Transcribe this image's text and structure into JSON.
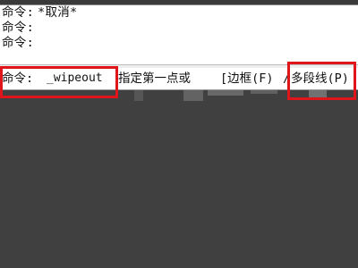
{
  "history": {
    "lines": [
      {
        "label": "命令:",
        "text": "*取消*"
      },
      {
        "label": "命令:",
        "text": ""
      },
      {
        "label": "命令:",
        "text": ""
      }
    ]
  },
  "command_line": {
    "label": "命令:",
    "input_value": "_wipeout",
    "prompt": "指定第一点或",
    "options": {
      "border": "[边框(F)",
      "separator": "/",
      "polyline": "多段线(P)"
    }
  },
  "colors": {
    "highlight": "#e0151b",
    "canvas_background": "#404040",
    "command_background": "#ffffff"
  }
}
